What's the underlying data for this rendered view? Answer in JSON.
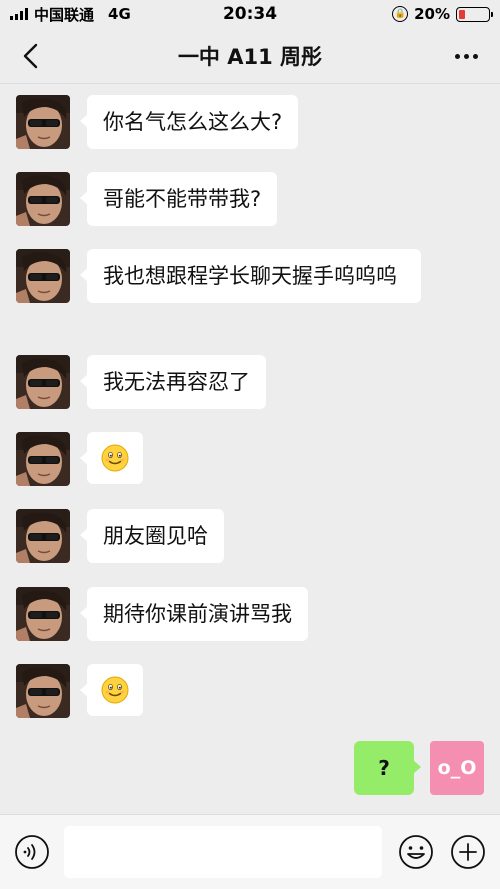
{
  "status_bar": {
    "carrier": "中国联通",
    "network": "4G",
    "time": "20:34",
    "battery_percent": "20%",
    "battery_level": 0.2
  },
  "nav": {
    "title": "一中 A11 周彤"
  },
  "messages": [
    {
      "text": "你名气怎么这么大?"
    },
    {
      "text": "哥能不能带带我?"
    },
    {
      "text": "我也想跟程学长聊天握手呜呜呜"
    },
    {
      "text": "我无法再容忍了"
    },
    {
      "emoji": "smiling-face-emoji"
    },
    {
      "text": "朋友圈见哈"
    },
    {
      "text": "期待你课前演讲骂我"
    },
    {
      "emoji": "smiling-face-emoji"
    }
  ],
  "self_message": {
    "text": "?",
    "avatar_text": "o_O"
  },
  "input_bar": {
    "placeholder": ""
  },
  "colors": {
    "self_bubble": "#95ec69",
    "self_avatar": "#f48fb1",
    "battery_low": "#e53935"
  }
}
